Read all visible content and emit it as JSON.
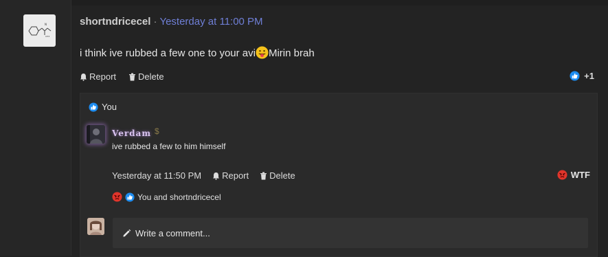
{
  "post": {
    "username": "shortndricecel",
    "separator": "·",
    "timestamp": "Yesterday at 11:00 PM",
    "message_before": "i think ive rubbed a few one to your avi",
    "message_after": "Mirin brah",
    "actions": {
      "report": "Report",
      "delete": "Delete"
    },
    "reaction_count": "+1"
  },
  "reactions_panel": {
    "you_label": "You"
  },
  "reply": {
    "username": "Verdam",
    "badge": "$",
    "text": "ive rubbed a few to him himself",
    "timestamp": "Yesterday at 11:50 PM",
    "actions": {
      "report": "Report",
      "delete": "Delete"
    },
    "reaction_label": "WTF",
    "reaction_summary": "You and shortndricecel"
  },
  "comment": {
    "placeholder": "Write a comment..."
  },
  "colors": {
    "link_blue": "#6f7fd6",
    "like_blue": "#1d8cf0",
    "angry_red": "#e0352b"
  }
}
